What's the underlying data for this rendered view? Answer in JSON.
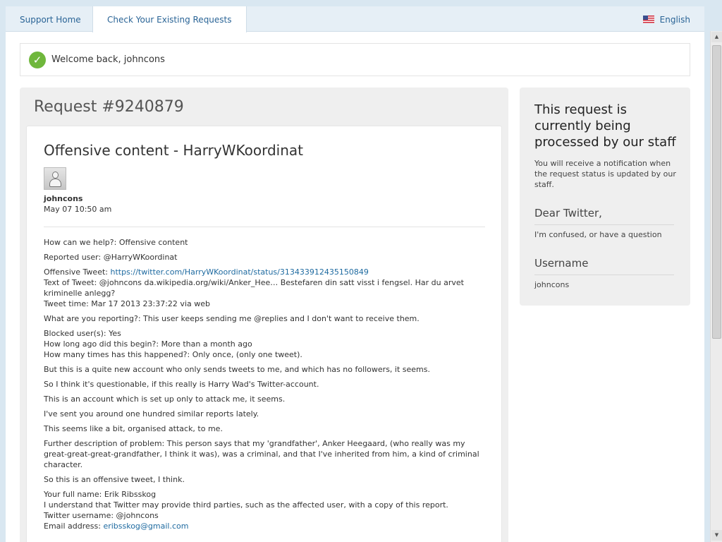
{
  "nav": {
    "tab_support_home": "Support Home",
    "tab_check_requests": "Check Your Existing Requests",
    "language": "English"
  },
  "welcome": {
    "text": "Welcome back, johncons"
  },
  "request": {
    "title": "Request #9240879",
    "subject": "Offensive content - HarryWKoordinat",
    "author": "johncons",
    "date": "May 07 10:50 am",
    "body": {
      "help": "How can we help?: Offensive content",
      "reported_user": "Reported user: @HarryWKoordinat",
      "tweet_label": "Offensive Tweet: ",
      "tweet_link": "https://twitter.com/HarryWKoordinat/status/313433912435150849",
      "tweet_text": "Text of Tweet: @johncons da.wikipedia.org/wiki/Anker_Hee… Bestefaren din satt visst i fengsel. Har du arvet kriminelle anlegg?",
      "tweet_time": "Tweet time: Mar 17 2013 23:37:22 via web",
      "reporting": "What are you reporting?: This user keeps sending me @replies and I don't want to receive them.",
      "blocked": "Blocked user(s): Yes",
      "how_long": "How long ago did this begin?: More than a month ago",
      "how_many": "How many times has this happened?: Only once, (only one tweet).",
      "p1": "But this is a quite new account who only sends tweets to me, and which has no followers, it seems.",
      "p2": "So I think it's questionable, if this really is Harry Wad's Twitter-account.",
      "p3": "This is an account which is set up only to attack me, it seems.",
      "p4": "I've sent you around one hundred similar reports lately.",
      "p5": "This seems like a bit, organised attack, to me.",
      "further": "Further description of problem: This person says that my 'grandfather', Anker Heegaard, (who really was my great-great-great-grandfather, I think it was), was a criminal, and that I've inherited from him, a kind of criminal character.",
      "p6": "So this is an offensive tweet, I think.",
      "full_name": "Your full name: Erik Ribsskog",
      "understand": "I understand that Twitter may provide third parties, such as the affected user, with a copy of this report.",
      "twitter_username": "Twitter username: @johncons",
      "email_label": "Email address: ",
      "email_link": "eribsskog@gmail.com"
    }
  },
  "sidebar": {
    "status_title": "This request is currently being processed by our staff",
    "status_note": "You will receive a notification when the request status is updated by our staff.",
    "field1_label": "Dear Twitter,",
    "field1_value": "I'm confused, or have a question",
    "field2_label": "Username",
    "field2_value": "johncons"
  },
  "icons": {
    "flag": "us-flag-icon",
    "welcome": "check-circle-icon",
    "avatar": "default-avatar-icon"
  },
  "colors": {
    "link": "#1e6aa0",
    "success": "#6fb73c",
    "panel_bg": "#efefef"
  }
}
